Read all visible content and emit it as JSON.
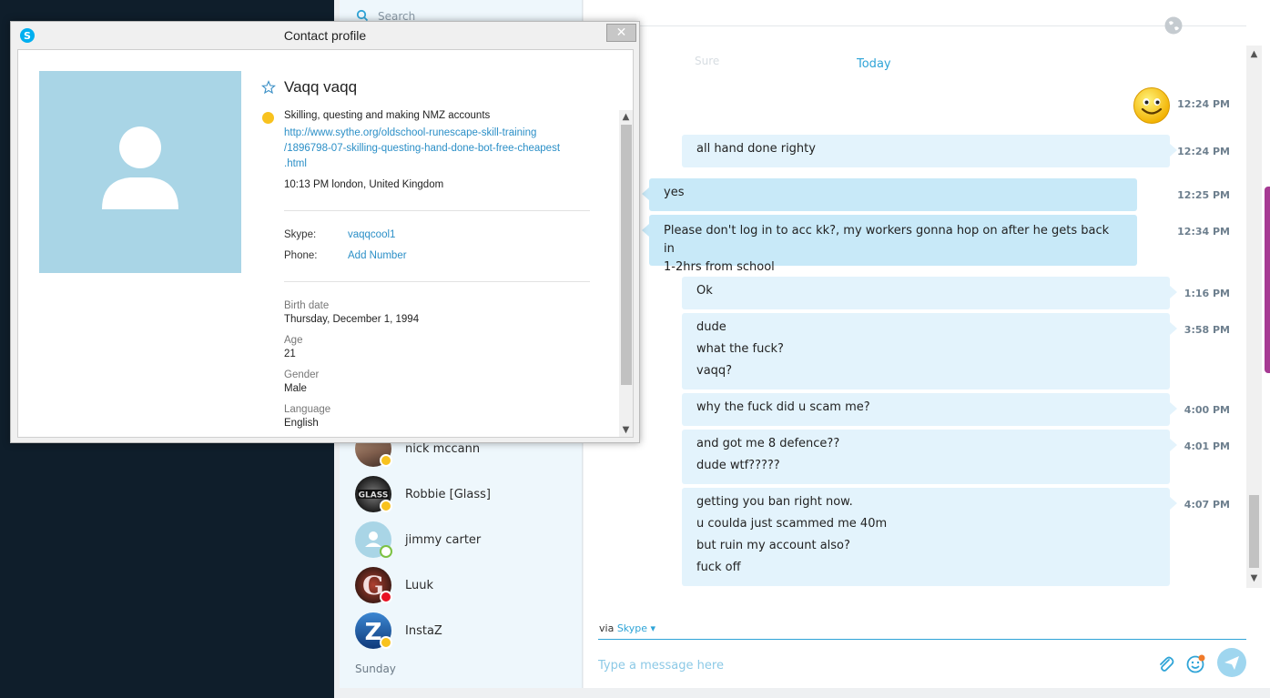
{
  "contacts": {
    "search_placeholder": "Search",
    "items": [
      {
        "name": "nick mccann",
        "status": "away"
      },
      {
        "name": "Robbie [Glass]",
        "status": "away"
      },
      {
        "name": "jimmy carter",
        "status": "online"
      },
      {
        "name": "Luuk",
        "status": "busy"
      },
      {
        "name": "InstaZ",
        "status": "away"
      }
    ],
    "section_label": "Sunday"
  },
  "chat": {
    "faded_text": "Sure",
    "day_divider": "Today",
    "messages": [
      {
        "from": "me",
        "type": "emoji",
        "time": "12:24 PM"
      },
      {
        "from": "me",
        "lines": [
          "all hand done righty"
        ],
        "time": "12:24 PM"
      },
      {
        "from": "them",
        "lines": [
          "yes"
        ],
        "time": "12:25 PM"
      },
      {
        "from": "them",
        "lines": [
          "Please don't log in to acc kk?, my workers gonna hop on after he gets back in",
          "1-2hrs from school"
        ],
        "time": "12:34 PM"
      },
      {
        "from": "me",
        "lines": [
          "Ok"
        ],
        "time": "1:16 PM"
      },
      {
        "from": "me",
        "lines": [
          "dude",
          "what the fuck?",
          "vaqq?"
        ],
        "time": "3:58 PM"
      },
      {
        "from": "me",
        "lines": [
          "why the fuck did u scam me?"
        ],
        "time": "4:00 PM"
      },
      {
        "from": "me",
        "lines": [
          "and got me 8 defence??",
          "dude wtf?????"
        ],
        "time": "4:01 PM"
      },
      {
        "from": "me",
        "lines": [
          "getting you ban right now.",
          "u coulda just scammed me 40m",
          "but ruin my account also?",
          "fuck off"
        ],
        "time": "4:07 PM"
      }
    ],
    "via_prefix": "via",
    "via_service": "Skype",
    "compose_placeholder": "Type a message here"
  },
  "profile": {
    "window_title": "Contact profile",
    "close_glyph": "✕",
    "name": "Vaqq vaqq",
    "mood": "Skilling, questing and making NMZ accounts",
    "mood_link_lines": [
      "http://www.sythe.org/oldschool-runescape-skill-training",
      "/1896798-07-skilling-questing-hand-done-bot-free-cheapest",
      ".html"
    ],
    "local_time": "10:13 PM london, United Kingdom",
    "skype_label": "Skype:",
    "skype_value": "vaqqcool1",
    "phone_label": "Phone:",
    "phone_value": "Add Number",
    "birth_label": "Birth date",
    "birth_value": "Thursday, December 1, 1994",
    "age_label": "Age",
    "age_value": "21",
    "gender_label": "Gender",
    "gender_value": "Male",
    "language_label": "Language",
    "language_value": "English"
  },
  "colors": {
    "accent": "#2fa4d7",
    "mine_bubble": "#e3f3fc",
    "their_bubble": "#c8e9f8",
    "avatar_bg": "#a9d5e6"
  }
}
